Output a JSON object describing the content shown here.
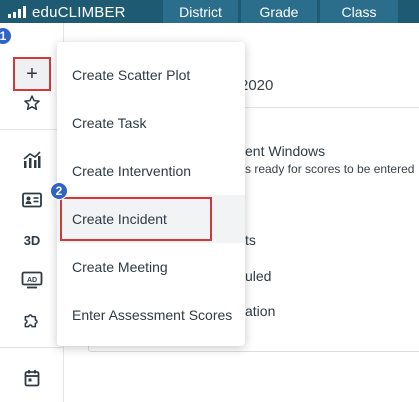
{
  "topbar": {
    "brand": "eduCLIMBER",
    "tabs": [
      "District",
      "Grade",
      "Class"
    ]
  },
  "sidebar": {
    "items": [
      {
        "icon": "plus-icon",
        "label": "+"
      },
      {
        "icon": "star-icon"
      },
      {
        "icon": "analytics-chart-icon"
      },
      {
        "icon": "student-id-card-icon"
      },
      {
        "icon": "3d-text-icon",
        "label": "3D"
      },
      {
        "icon": "ad-display-icon",
        "label": "AD"
      },
      {
        "icon": "puzzle-icon"
      },
      {
        "icon": "calendar-icon"
      }
    ]
  },
  "steps": {
    "step1": "1",
    "step2": "2"
  },
  "background": {
    "year": "2020",
    "line1": "ent Windows",
    "line2": "s ready for scores to be entered",
    "line3": "ts",
    "line4": "uled",
    "line5": "ation"
  },
  "menu": {
    "items": [
      "Create Scatter Plot",
      "Create Task",
      "Create Intervention",
      "Create Incident",
      "Create Meeting",
      "Enter Assessment Scores"
    ],
    "highlighted_index": 3
  },
  "colors": {
    "topbar": "#1f5a73",
    "tab": "#2b6e8b",
    "highlight_border": "#d13a3a",
    "step_badge": "#2f63c7"
  }
}
